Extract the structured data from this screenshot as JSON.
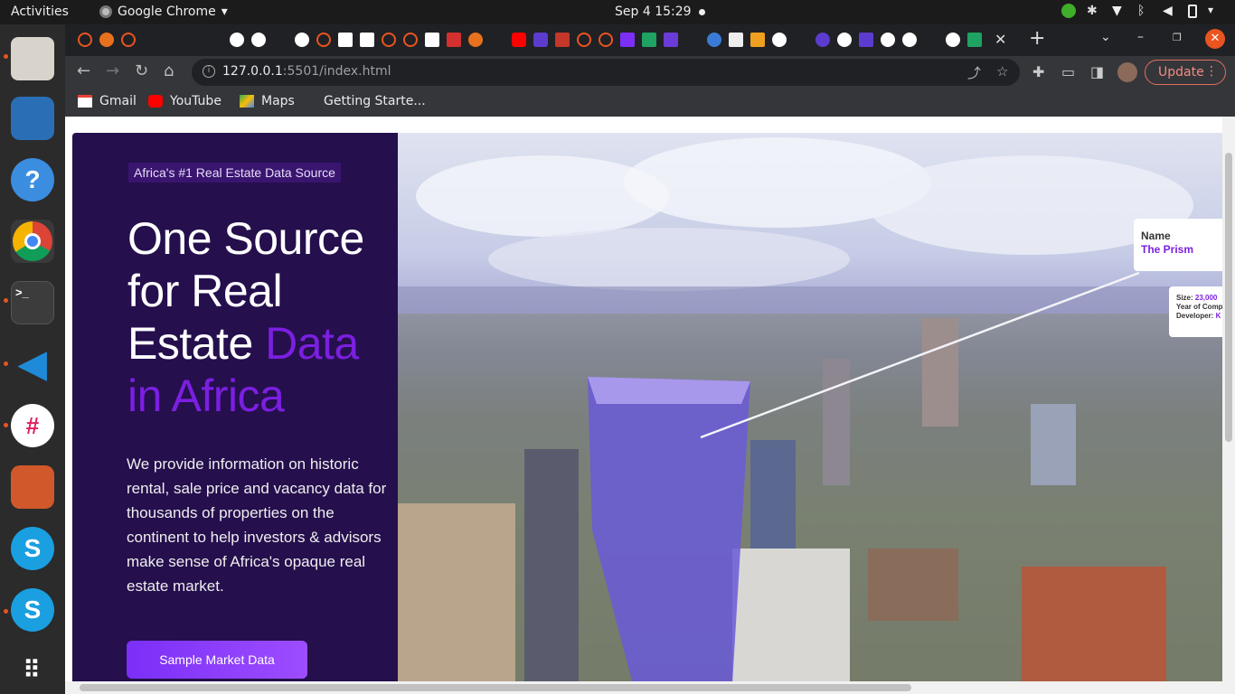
{
  "topbar": {
    "activities": "Activities",
    "app_name": "Google Chrome",
    "datetime": "Sep 4  15:29"
  },
  "browser": {
    "url_host": "127.0.0.1",
    "url_path": ":5501/index.html",
    "update_label": "Update",
    "bookmarks": [
      {
        "label": "Gmail",
        "icon": "gmail-icon"
      },
      {
        "label": "YouTube",
        "icon": "youtube-icon"
      },
      {
        "label": "Maps",
        "icon": "maps-icon"
      },
      {
        "label": "Getting Starte...",
        "icon": "page-icon"
      }
    ]
  },
  "hero": {
    "tagline": "Africa's #1 Real Estate Data Source",
    "headline_main": "One Source for Real Estate ",
    "headline_accent": "Data in Africa",
    "description": "We provide information on historic rental, sale price and vacancy data for thousands of properties on the continent to help investors & advisors make sense of Africa's opaque real estate market.",
    "cta": "Sample Market Data",
    "accent_color": "#7b1fe0",
    "panel_color": "#250f4d"
  },
  "overlay": {
    "name_label": "Name",
    "name_value": "The Prism",
    "size_label": "Size:",
    "size_value": "23,000",
    "year_label": "Year of Comp",
    "developer_label": "Developer:",
    "developer_value": "K"
  }
}
